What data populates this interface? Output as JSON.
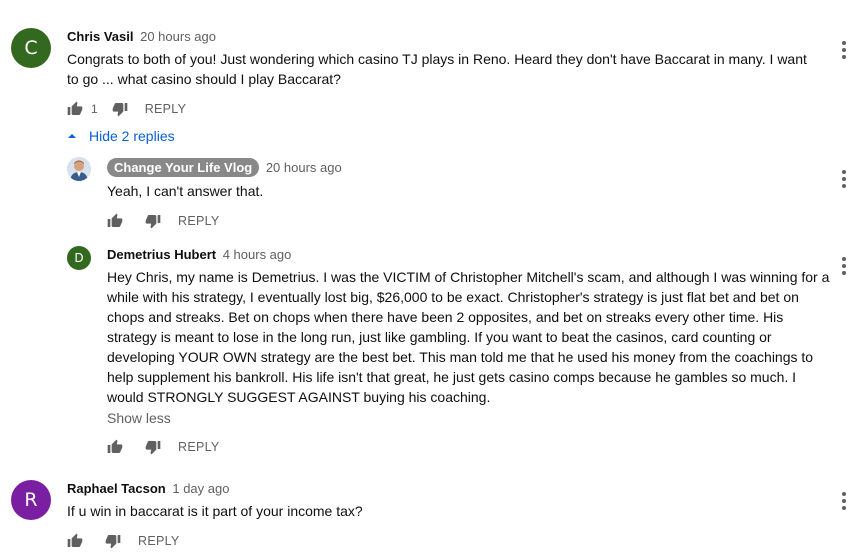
{
  "comments": [
    {
      "avatar_letter": "C",
      "avatar_color": "#33691e",
      "author": "Chris Vasil",
      "time": "20 hours ago",
      "lines": [
        "Congrats to both of you!  Just wondering which casino TJ plays in Reno.  Heard they don't have Baccarat in many.   I want",
        "to go ... what casino should I play Baccarat?"
      ],
      "likes": "1",
      "reply_label": "REPLY",
      "replies_toggle": "Hide 2 replies",
      "replies": [
        {
          "author": "Change Your Life Vlog",
          "time": "20 hours ago",
          "lines": [
            "Yeah, I can't answer that."
          ],
          "reply_label": "REPLY"
        },
        {
          "avatar_letter": "D",
          "avatar_color": "#33691e",
          "author": "Demetrius Hubert",
          "time": "4 hours ago",
          "lines": [
            "Hey Chris, my name is Demetrius. I was the VICTIM of Christopher Mitchell's scam, and although I was winning for a",
            "while with his strategy, I eventually lost big, $26,000 to be exact. Christopher's strategy is just flat bet and bet on",
            "chops and streaks. Bet on chops when there have been 2 opposites, and bet on streaks every other time. His",
            "strategy is meant to lose in the long run, just like gambling. If you want to beat the casinos, card counting or",
            "developing YOUR OWN strategy are the best bet. This man told me that he used his money from the coachings to",
            "help supplement his bankroll. His life isn't that great, he just gets casino comps because he gambles so much. I",
            "would STRONGLY SUGGEST AGAINST buying his coaching."
          ],
          "show_less": "Show less",
          "reply_label": "REPLY"
        }
      ]
    },
    {
      "avatar_letter": "R",
      "avatar_color": "#7b1fa2",
      "author": "Raphael Tacson",
      "time": "1 day ago",
      "lines": [
        "If u win in baccarat is it part of your income tax?"
      ],
      "reply_label": "REPLY"
    }
  ]
}
